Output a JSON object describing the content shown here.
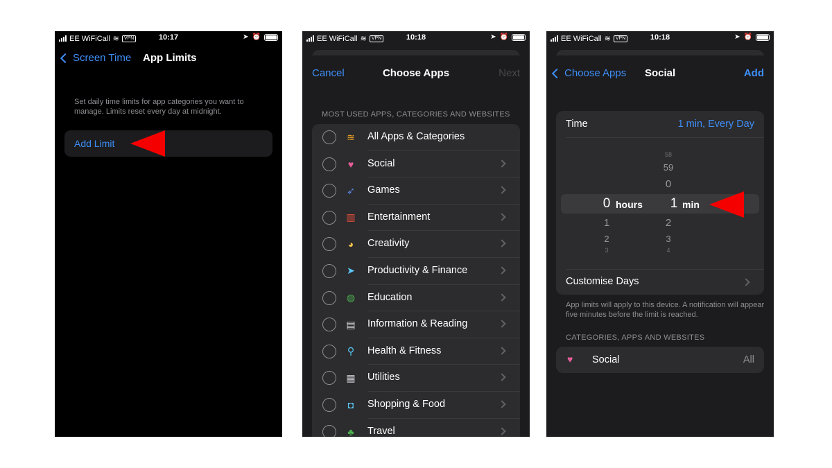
{
  "colors": {
    "accent": "#3e8ef7",
    "arrow": "#f40000",
    "disabled": "#48484a"
  },
  "status_bars": [
    {
      "carrier": "EE WiFiCall",
      "vpn": "VPN",
      "time": "10:17"
    },
    {
      "carrier": "EE WiFiCall",
      "vpn": "VPN",
      "time": "10:18"
    },
    {
      "carrier": "EE WiFiCall",
      "vpn": "VPN",
      "time": "10:18"
    }
  ],
  "screen1": {
    "back_label": "Screen Time",
    "title": "App Limits",
    "description": "Set daily time limits for app categories you want to manage. Limits reset every day at midnight.",
    "add_limit_label": "Add Limit"
  },
  "screen2": {
    "cancel_label": "Cancel",
    "title": "Choose Apps",
    "next_label": "Next",
    "section_header": "MOST USED APPS, CATEGORIES AND WEBSITES",
    "categories": [
      {
        "label": "All Apps & Categories",
        "icon": "stack-icon",
        "glyph": "≋",
        "color": "#f5a623",
        "chevron": false
      },
      {
        "label": "Social",
        "icon": "speech-bubble-icon",
        "glyph": "♥",
        "color": "#e85d9a",
        "chevron": true
      },
      {
        "label": "Games",
        "icon": "rocket-icon",
        "glyph": "➶",
        "color": "#5b8def",
        "chevron": true
      },
      {
        "label": "Entertainment",
        "icon": "popcorn-icon",
        "glyph": "▥",
        "color": "#e8503a",
        "chevron": true
      },
      {
        "label": "Creativity",
        "icon": "palette-icon",
        "glyph": "◕",
        "color": "#f2c14e",
        "chevron": true
      },
      {
        "label": "Productivity & Finance",
        "icon": "paper-plane-icon",
        "glyph": "➤",
        "color": "#5ac8fa",
        "chevron": true
      },
      {
        "label": "Education",
        "icon": "globe-icon",
        "glyph": "◍",
        "color": "#4caf50",
        "chevron": true
      },
      {
        "label": "Information & Reading",
        "icon": "book-icon",
        "glyph": "▤",
        "color": "#d8d8d8",
        "chevron": true
      },
      {
        "label": "Health & Fitness",
        "icon": "bicycle-icon",
        "glyph": "⚲",
        "color": "#5ac8fa",
        "chevron": true
      },
      {
        "label": "Utilities",
        "icon": "calculator-icon",
        "glyph": "▦",
        "color": "#c7c7cc",
        "chevron": true
      },
      {
        "label": "Shopping & Food",
        "icon": "shopping-bag-icon",
        "glyph": "◘",
        "color": "#5ac8fa",
        "chevron": true
      },
      {
        "label": "Travel",
        "icon": "palm-tree-icon",
        "glyph": "♣",
        "color": "#4caf50",
        "chevron": true
      }
    ]
  },
  "screen3": {
    "back_label": "Choose Apps",
    "title": "Social",
    "add_label": "Add",
    "time_label": "Time",
    "time_value": "1 min, Every Day",
    "hours_values": [
      "0",
      "1",
      "2",
      "3"
    ],
    "hours_unit": "hours",
    "minutes_values": [
      "58",
      "59",
      "0",
      "1",
      "2",
      "3",
      "4"
    ],
    "minutes_unit": "min",
    "customise_label": "Customise Days",
    "footnote": "App limits will apply to this device. A notification will appear five minutes before the limit is reached.",
    "section_header": "CATEGORIES, APPS AND WEBSITES",
    "social_label": "Social",
    "social_value": "All"
  }
}
